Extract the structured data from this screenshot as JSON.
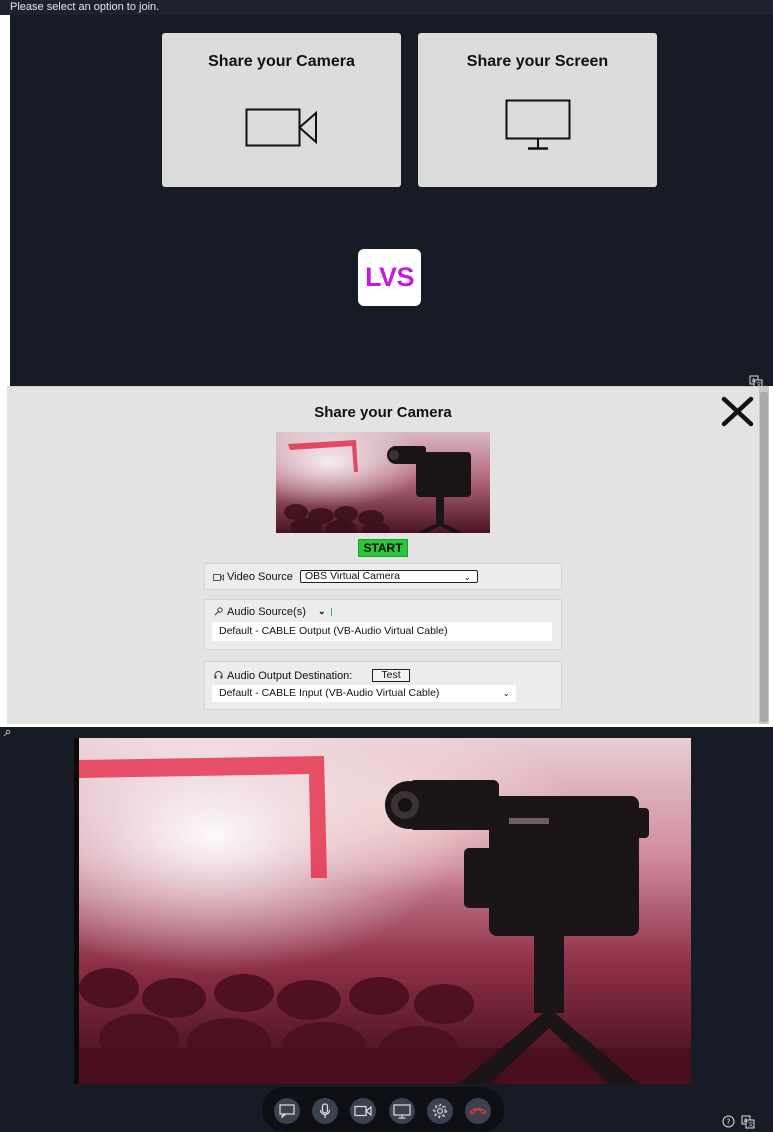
{
  "join": {
    "prompt": "Please select an option to join.",
    "camera_option": "Share your Camera",
    "screen_option": "Share your Screen",
    "logo_text": "LVS",
    "logo_color": "#c21fd8"
  },
  "camera_modal": {
    "title": "Share your Camera",
    "start_label": "START",
    "start_color": "#27c93a",
    "video_source": {
      "label": "Video Source",
      "selected": "OBS Virtual Camera"
    },
    "audio_source": {
      "label": "Audio Source(s)",
      "device": "Default - CABLE Output (VB-Audio Virtual Cable)"
    },
    "audio_output": {
      "label": "Audio Output Destination:",
      "test_label": "Test",
      "device": "Default - CABLE Input (VB-Audio Virtual Cable)"
    }
  },
  "controls": {
    "end_call_color": "#d93a3a",
    "icons": [
      "chat-icon",
      "microphone-icon",
      "camera-icon",
      "screen-share-icon",
      "settings-icon",
      "hang-up-icon"
    ]
  }
}
